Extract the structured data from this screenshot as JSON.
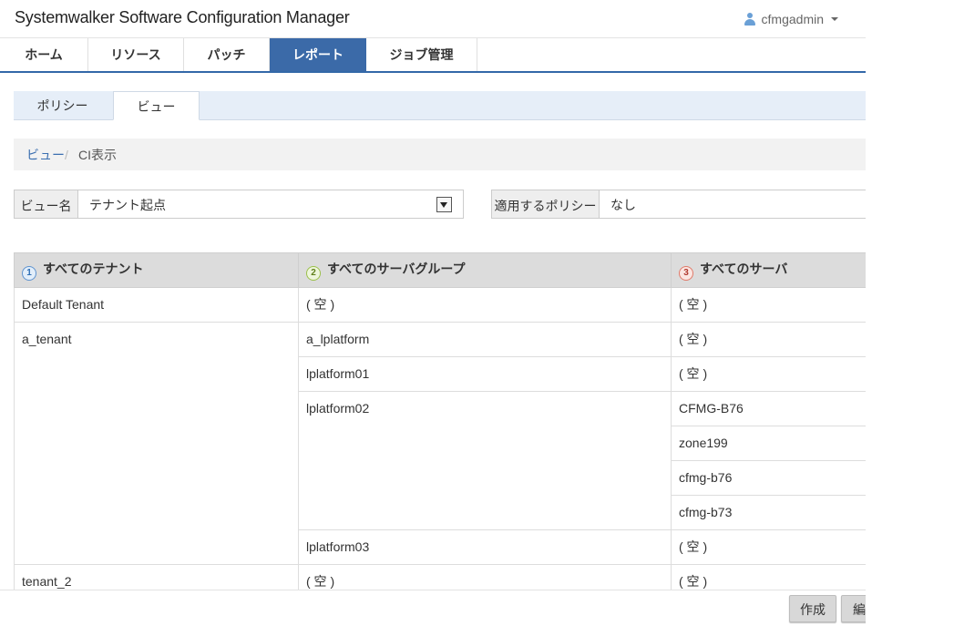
{
  "header": {
    "app_title": "Systemwalker Software Configuration Manager",
    "username": "cfmgadmin"
  },
  "main_nav": [
    "ホーム",
    "リソース",
    "パッチ",
    "レポート",
    "ジョブ管理"
  ],
  "sub_tabs": [
    "ポリシー",
    "ビュー"
  ],
  "breadcrumb": {
    "link": "ビュー",
    "separator": "/",
    "current": "CI表示"
  },
  "view_name": {
    "label": "ビュー名",
    "value": "テナント起点"
  },
  "policy": {
    "label": "適用するポリシー",
    "value": "なし"
  },
  "table": {
    "col1": {
      "num": "1",
      "title": "すべてのテナント"
    },
    "col2": {
      "num": "2",
      "title": "すべてのサーバグループ"
    },
    "col3": {
      "num": "3",
      "title": "すべてのサーバ"
    },
    "cells": {
      "t1": "Default Tenant",
      "t1_g1": "( 空 )",
      "t1_s1": "( 空 )",
      "t2": "a_tenant",
      "t2_g1": "a_lplatform",
      "t2_g1_s1": "( 空 )",
      "t2_g2": "lplatform01",
      "t2_g2_s1": "( 空 )",
      "t2_g3": "lplatform02",
      "t2_g3_s1": "CFMG-B76",
      "t2_g3_s2": "zone199",
      "t2_g3_s3": "cfmg-b76",
      "t2_g3_s4": "cfmg-b73",
      "t2_g4": "lplatform03",
      "t2_g4_s1": "( 空 )",
      "t3": "tenant_2",
      "t3_g1": "( 空 )",
      "t3_s1": "( 空 )"
    }
  },
  "footer": {
    "create": "作成",
    "edit": "編"
  },
  "colors": {
    "accent": "#3b6aa8",
    "link": "#3b6fb0"
  }
}
